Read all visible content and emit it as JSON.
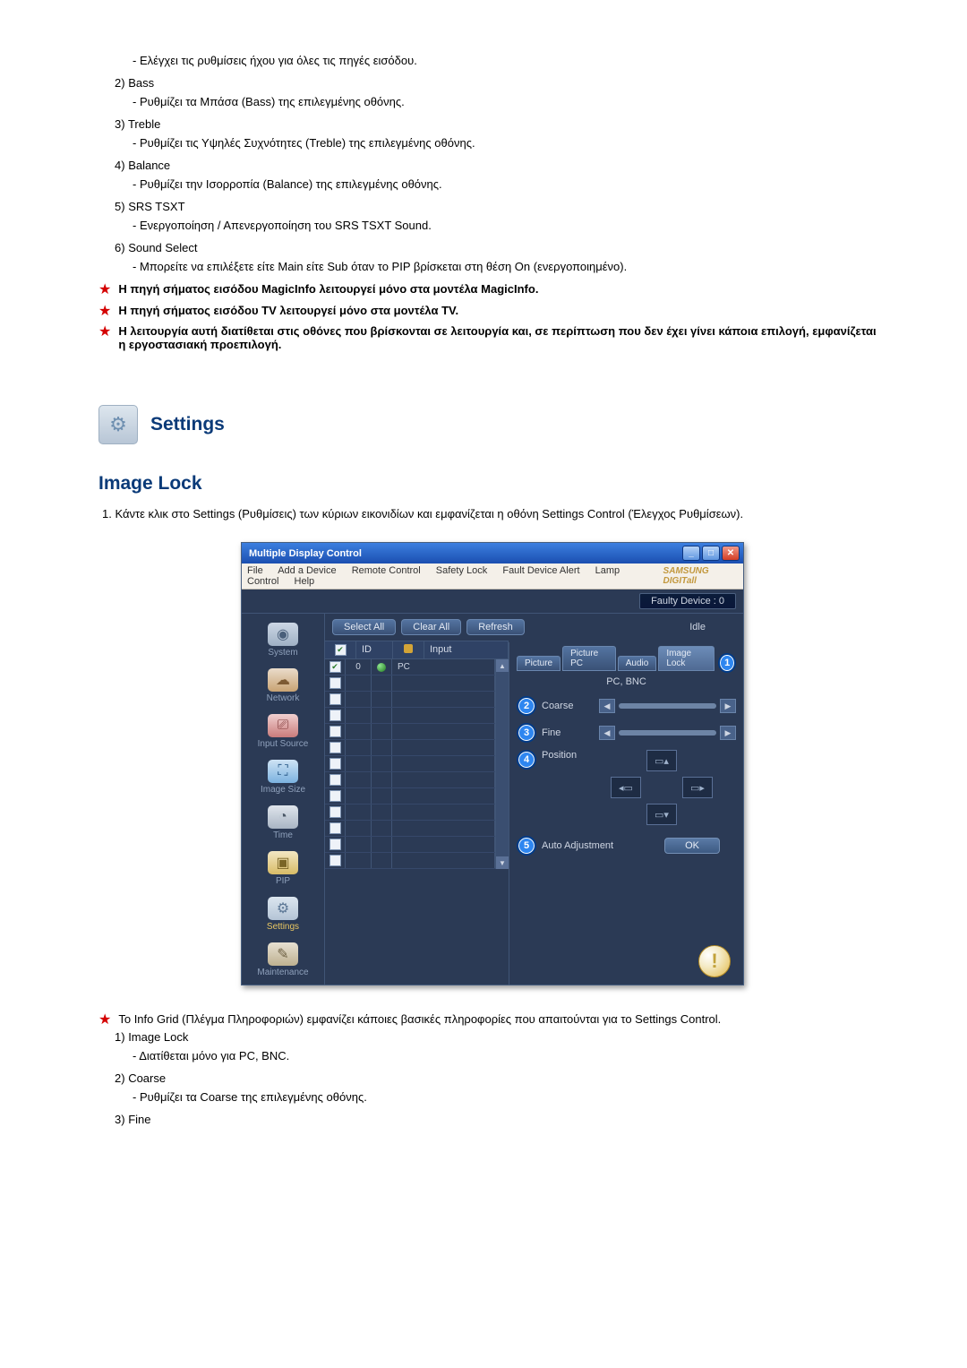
{
  "sound_items": [
    {
      "num": "",
      "title": "",
      "desc": "- Ελέγχει τις ρυθμίσεις ήχου για όλες τις πηγές εισόδου."
    },
    {
      "num": "2)",
      "title": "Bass",
      "desc": "- Ρυθμίζει τα Μπάσα (Bass) της επιλεγμένης οθόνης."
    },
    {
      "num": "3)",
      "title": "Treble",
      "desc": "- Ρυθμίζει τις Υψηλές Συχνότητες (Treble) της επιλεγμένης οθόνης."
    },
    {
      "num": "4)",
      "title": "Balance",
      "desc": "- Ρυθμίζει την Ισορροπία (Balance) της επιλεγμένης οθόνης."
    },
    {
      "num": "5)",
      "title": "SRS TSXT",
      "desc": "- Ενεργοποίηση / Απενεργοποίηση του SRS TSXT Sound."
    },
    {
      "num": "6)",
      "title": "Sound Select",
      "desc": "- Μπορείτε να επιλέξετε είτε Main είτε Sub όταν το PIP βρίσκεται στη θέση On (ενεργοποιημένο)."
    }
  ],
  "notes": [
    "Η πηγή σήματος εισόδου MagicInfo λειτουργεί μόνο στα μοντέλα MagicInfo.",
    "Η πηγή σήματος εισόδου TV λειτουργεί μόνο στα μοντέλα TV.",
    "Η λειτουργία αυτή διατίθεται στις οθόνες που βρίσκονται σε λειτουργία και, σε περίπτωση που δεν έχει γίνει κάποια επιλογή, εμφανίζεται η εργοστασιακή προεπιλογή."
  ],
  "settings_title": "Settings",
  "image_lock_title": "Image Lock",
  "image_lock_intro": "1.  Κάντε κλικ στο Settings (Ρυθμίσεις) των κύριων εικονιδίων και εμφανίζεται η οθόνη Settings Control (Έλεγχος Ρυθμίσεων).",
  "after_shot_note": "Το Info Grid (Πλέγμα Πληροφοριών) εμφανίζει κάποιες βασικές πληροφορίες που απαιτούνται για το Settings Control.",
  "after_items": [
    {
      "num": "1)",
      "title": "Image Lock",
      "desc": "- Διατίθεται μόνο για PC, BNC."
    },
    {
      "num": "2)",
      "title": "Coarse",
      "desc": "- Ρυθμίζει τα Coarse της επιλεγμένης οθόνης."
    },
    {
      "num": "3)",
      "title": "Fine",
      "desc": ""
    }
  ],
  "app": {
    "title": "Multiple Display Control",
    "menu": [
      "File",
      "Add a Device",
      "Remote Control",
      "Safety Lock",
      "Fault Device Alert",
      "Lamp Control",
      "Help"
    ],
    "brand": "SAMSUNG DIGITall",
    "faulty": "Faulty Device : 0",
    "actions": {
      "select_all": "Select All",
      "clear_all": "Clear All",
      "refresh": "Refresh",
      "idle": "Idle"
    },
    "grid_head": {
      "id": "ID",
      "input": "Input"
    },
    "row0": {
      "id": "0",
      "input": "PC"
    },
    "sidebar": [
      "System",
      "Network",
      "Input Source",
      "Image Size",
      "Time",
      "PIP",
      "Settings",
      "Maintenance"
    ],
    "tabs": [
      "Picture",
      "Picture PC",
      "Audio",
      "Image Lock"
    ],
    "pcbn": "PC, BNC",
    "coarse": "Coarse",
    "fine": "Fine",
    "position": "Position",
    "auto": "Auto Adjustment",
    "ok": "OK",
    "callouts": [
      "1",
      "2",
      "3",
      "4",
      "5"
    ]
  }
}
